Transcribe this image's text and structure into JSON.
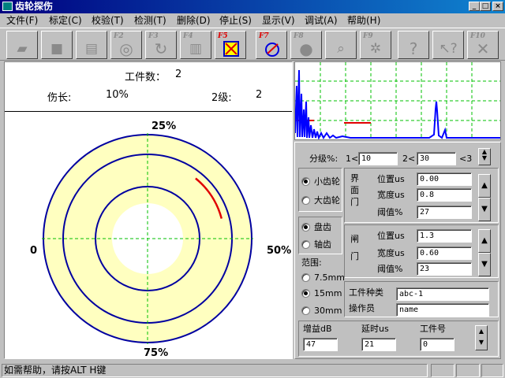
{
  "window": {
    "title": "齿轮探伤"
  },
  "menu": [
    {
      "label": "文件(F)"
    },
    {
      "label": "标定(C)"
    },
    {
      "label": "校验(T)"
    },
    {
      "label": "检测(T)"
    },
    {
      "label": "删除(D)"
    },
    {
      "label": "停止(S)"
    },
    {
      "label": "显示(V)"
    },
    {
      "label": "调试(A)"
    },
    {
      "label": "帮助(H)"
    }
  ],
  "toolbar": {
    "f2": "F2",
    "f3": "F3",
    "f4": "F4",
    "f5": "F5",
    "f7": "F7",
    "f8": "F8",
    "f9": "F9",
    "f10": "F10"
  },
  "main": {
    "count_label": "工件数：",
    "count_value": "2",
    "defect_label": "伤长:",
    "defect_value": "10%",
    "grade_label": "2级:",
    "grade_value": "2",
    "angle_top": "25%",
    "angle_left": "0",
    "angle_right": "50%",
    "angle_bottom": "75%"
  },
  "panel": {
    "grade_label": "分级%:",
    "grade_1_prefix": "1<",
    "grade_1_value": "10",
    "grade_2_prefix": "2<",
    "grade_2_value": "30",
    "grade_3_suffix": "<3",
    "gear_small": "小齿轮",
    "gear_large": "大齿轮",
    "gate1_title": "界面门",
    "gate1_pos_label": "位置us",
    "gate1_pos_value": "0.00",
    "gate1_width_label": "宽度us",
    "gate1_width_value": "0.8",
    "gate1_thresh_label": "阈值%",
    "gate1_thresh_value": "27",
    "type_disc": "盘齿",
    "type_shaft": "轴齿",
    "gate2_title": "闸门",
    "gate2_pos_label": "位置us",
    "gate2_pos_value": "1.3",
    "gate2_width_label": "宽度us",
    "gate2_width_value": "0.60",
    "gate2_thresh_label": "阈值%",
    "gate2_thresh_value": "23",
    "range_label": "范围:",
    "range_1": "7.5mm",
    "range_2": "15mm",
    "range_3": "30mm",
    "part_type_label": "工件种类",
    "part_type_value": "abc-1",
    "operator_label": "操作员",
    "operator_value": "name",
    "gain_label": "增益dB",
    "gain_value": "47",
    "delay_label": "延时us",
    "delay_value": "21",
    "part_no_label": "工件号",
    "part_no_value": "0"
  },
  "status": {
    "text": "如需帮助，请按ALT H键"
  },
  "colors": {
    "ring_fill": "#ffffc0",
    "ring_stroke": "#0000a0",
    "defect": "#e00000",
    "grid": "#00c000",
    "trace": "#0000ff"
  }
}
